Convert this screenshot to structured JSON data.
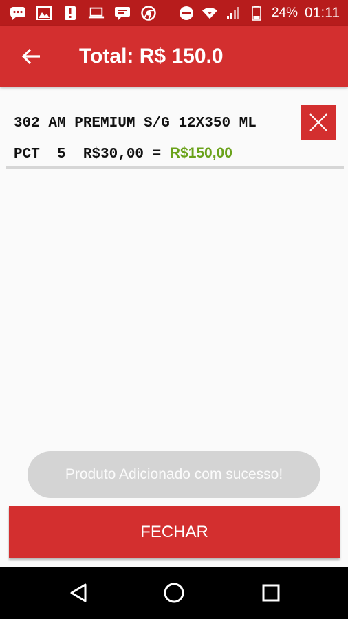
{
  "status_bar": {
    "battery_percent": "24%",
    "time": "01:11",
    "icons": [
      "message-icon",
      "image-icon",
      "alert-icon",
      "laptop-icon",
      "chat-icon",
      "chrome-icon",
      "do-not-disturb-icon",
      "wifi-icon",
      "signal-icon",
      "battery-icon"
    ]
  },
  "app_bar": {
    "title": "Total: R$ 150.0",
    "back_icon": "arrow-back-icon"
  },
  "item": {
    "description": "302 AM PREMIUM S/G 12X350 ML",
    "unit_qty_price": "PCT  5  R$30,00 = ",
    "line_total": "R$150,00",
    "remove_icon": "close-icon"
  },
  "toast": {
    "message": "Produto Adicionado com sucesso!"
  },
  "footer": {
    "close_label": "FECHAR"
  },
  "nav_bar": {
    "icons": [
      "back-triangle-icon",
      "home-circle-icon",
      "recents-square-icon"
    ]
  },
  "colors": {
    "status_bar": "#b71c1c",
    "primary": "#d32f2f",
    "total_green": "#6aa21a",
    "toast_bg": "#d4d4d4"
  }
}
